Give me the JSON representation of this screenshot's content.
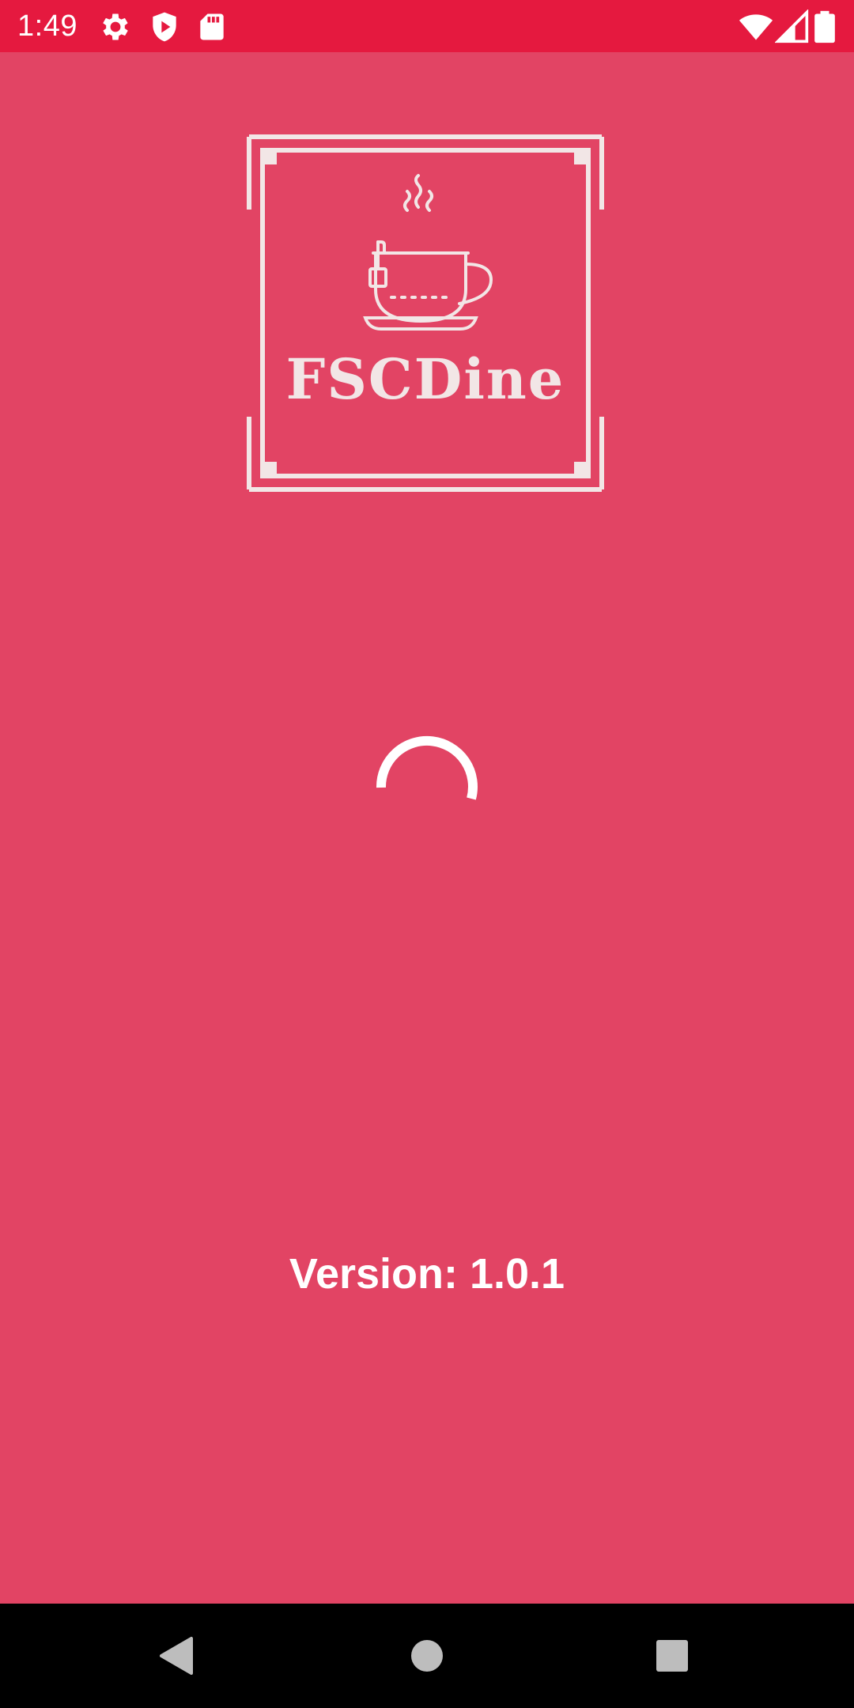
{
  "status_bar": {
    "time": "1:49",
    "background_color": "#E5193F",
    "left_icons": [
      "gear-icon",
      "shield-play-icon",
      "sd-card-icon"
    ],
    "right_icons": [
      "wifi-icon",
      "cell-signal-icon",
      "battery-icon"
    ]
  },
  "splash": {
    "background_color": "#E24464",
    "logo_text": "FSCDine",
    "logo_icon": "coffee-cup-icon",
    "loading_indicator": "spinner",
    "version_text": "Version: 1.0.1"
  },
  "nav_bar": {
    "buttons": [
      "back-icon",
      "home-icon",
      "recents-icon"
    ]
  }
}
